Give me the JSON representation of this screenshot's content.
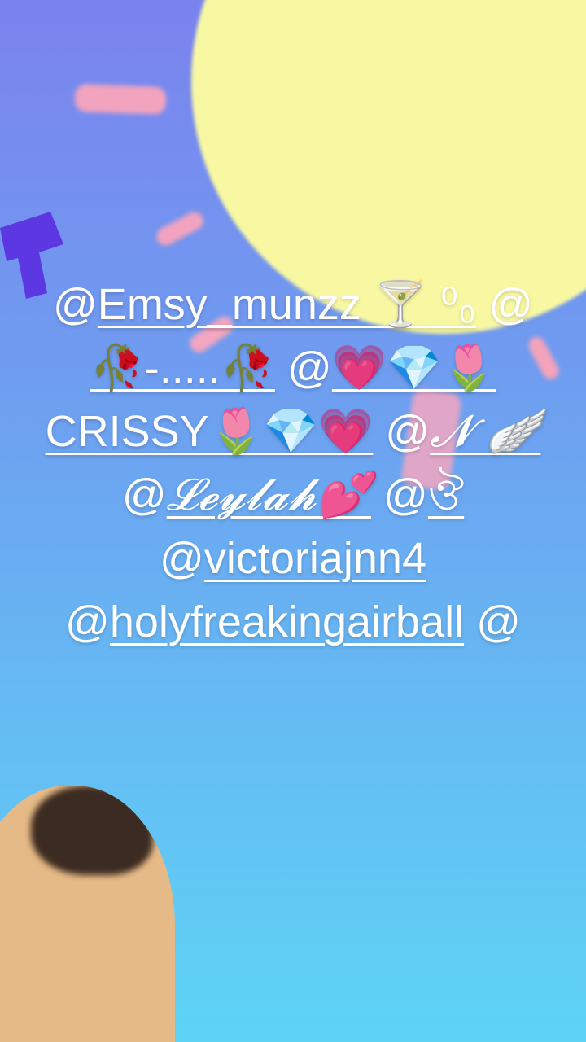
{
  "mentions": [
    {
      "at": "@",
      "handle": "Emsy_munzz 🍸 ⁰₀"
    },
    {
      "at": "@",
      "handle": "🥀-.....🥀"
    },
    {
      "at": "@",
      "handle": "💗💎🌷 CRISSY🌷💎💗"
    },
    {
      "at": "@",
      "handle": "𝓝 🪽"
    },
    {
      "at": "@",
      "handle": "𝓛𝓮𝔂𝓵𝓪𝓱💕"
    },
    {
      "at": "@",
      "handle": "ঔ"
    },
    {
      "at": "@",
      "handle": "victoriajnn4"
    },
    {
      "at": "@",
      "handle": "holyfreakingairball"
    },
    {
      "at": "@",
      "handle": ""
    }
  ],
  "colors": {
    "bg_top": "#7b83ee",
    "bg_bottom": "#5ed4f5",
    "sun": "#f9f8a2",
    "confetti": "#f2a3bd",
    "text": "#ffffff"
  }
}
